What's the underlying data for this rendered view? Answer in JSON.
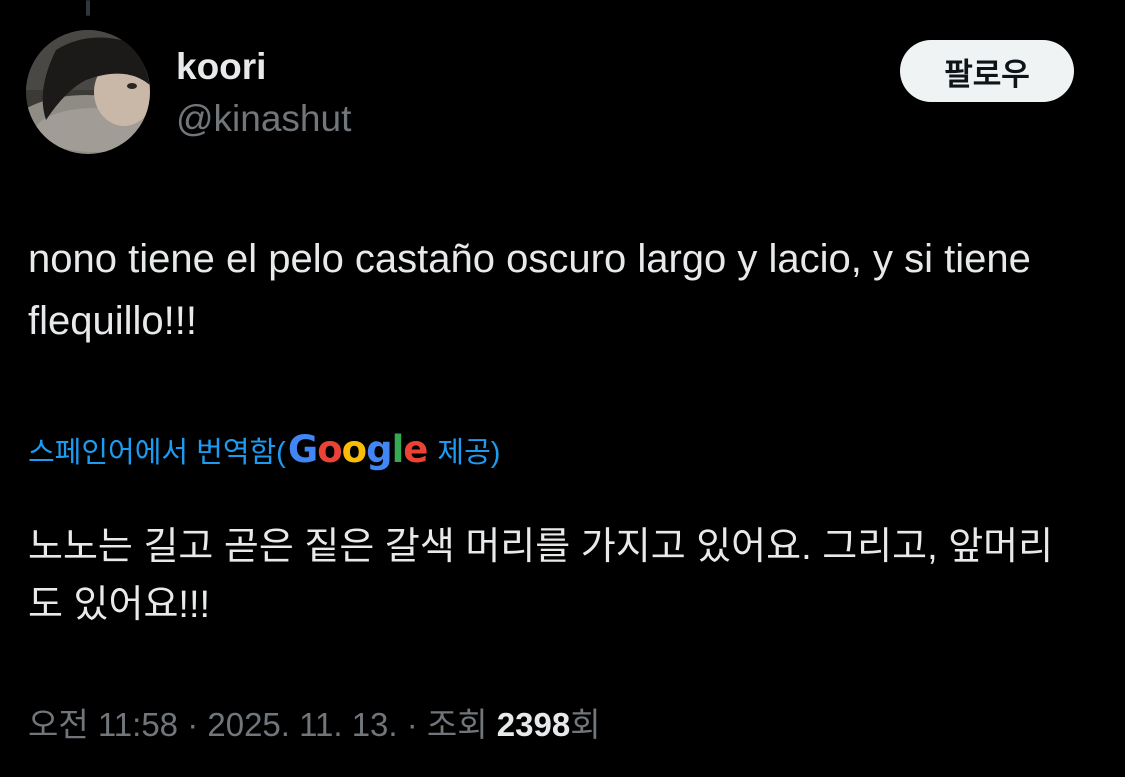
{
  "author": {
    "display_name": "koori",
    "handle": "@kinashut",
    "avatar": "profile-photo"
  },
  "follow_button": {
    "label": "팔로우"
  },
  "tweet": {
    "text": "nono tiene el pelo castaño oscuro largo y lacio, y si tiene flequillo!!!"
  },
  "translation": {
    "prefix": "스페인어에서 번역함(",
    "provider": "Google",
    "suffix": " 제공)",
    "text": "노노는 길고 곧은 짙은 갈색 머리를 가지고 있어요. 그리고, 앞머리도 있어요!!!"
  },
  "meta": {
    "time": "오전 11:58",
    "separator": " · ",
    "date": "2025. 11. 13.",
    "views_label": "조회 ",
    "views_count": "2398",
    "views_suffix": "회"
  },
  "colors": {
    "background": "#000000",
    "text": "#e7e9ea",
    "secondary": "#71767b",
    "link": "#1d9bf0",
    "google_blue": "#4285f4",
    "google_red": "#ea4335",
    "google_yellow": "#fbbc05",
    "google_green": "#34a853"
  }
}
